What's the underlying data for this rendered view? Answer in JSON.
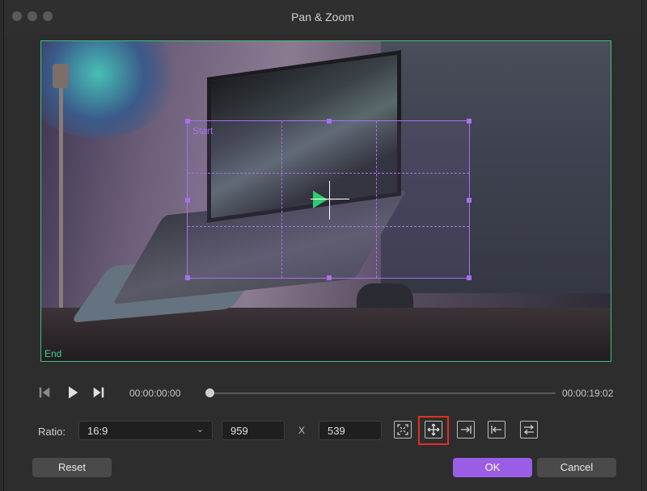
{
  "window": {
    "title": "Pan & Zoom"
  },
  "preview": {
    "start_label": "Start",
    "end_label": "End"
  },
  "transport": {
    "current_time": "00:00:00:00",
    "end_time": "00:00:19:02",
    "position": 0.0
  },
  "ratio": {
    "label": "Ratio:",
    "selected": "16:9",
    "width": "959",
    "separator": "X",
    "height": "539"
  },
  "buttons": {
    "reset": "Reset",
    "ok": "OK",
    "cancel": "Cancel"
  },
  "colors": {
    "accent": "#9a5de6",
    "start_box": "#a86ff0",
    "end_box": "#3fbf7f",
    "highlight": "#e0301e"
  }
}
